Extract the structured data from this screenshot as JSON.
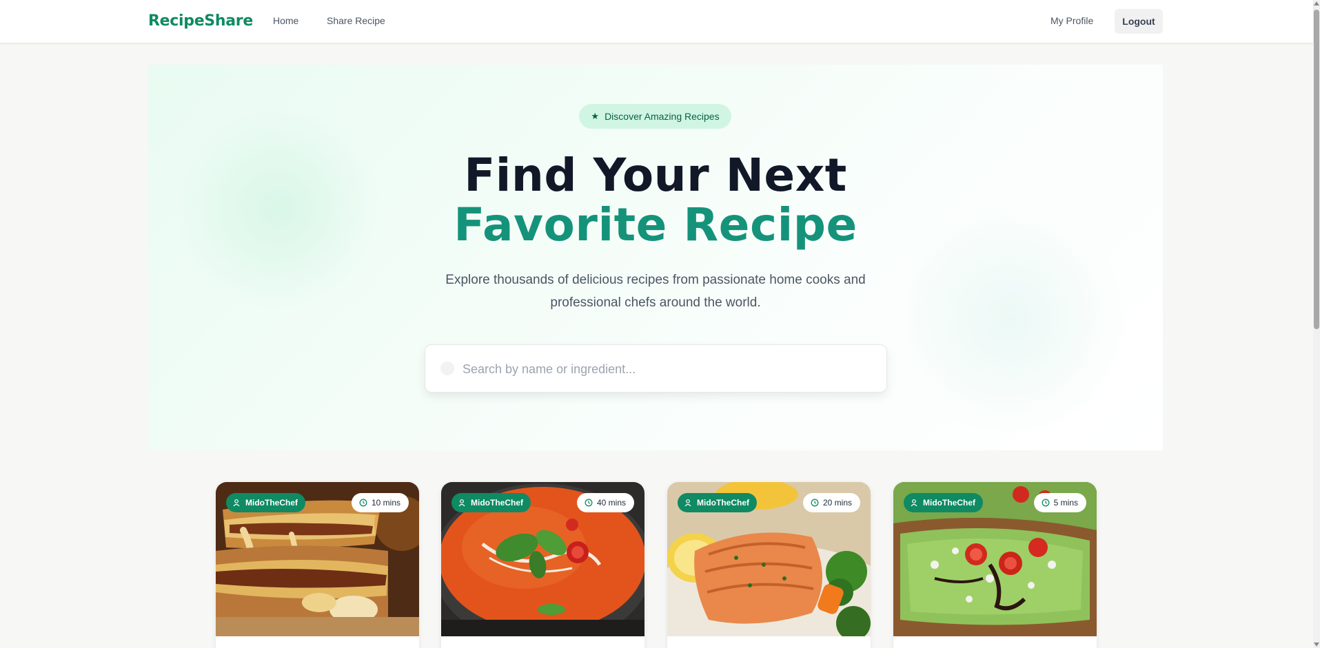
{
  "navbar": {
    "brand": "RecipeShare",
    "links": [
      "Home",
      "Share Recipe"
    ],
    "profile": "My Profile",
    "logout": "Logout"
  },
  "hero": {
    "badge": "Discover Amazing Recipes",
    "headline_line1": "Find Your Next",
    "headline_line2": "Favorite Recipe",
    "subtitle": "Explore thousands of delicious recipes from passionate home cooks and professional chefs around the world.",
    "search_placeholder": "Search by name or ingredient..."
  },
  "recipes": [
    {
      "chef": "MidoTheChef",
      "time": "10 mins",
      "image": "grilled-cheese-sandwich"
    },
    {
      "chef": "MidoTheChef",
      "time": "40 mins",
      "image": "tomato-soup"
    },
    {
      "chef": "MidoTheChef",
      "time": "20 mins",
      "image": "grilled-salmon"
    },
    {
      "chef": "MidoTheChef",
      "time": "5 mins",
      "image": "avocado-toast"
    }
  ],
  "colors": {
    "brand": "#0f8a63",
    "headline_dark": "#111827",
    "headline_accent": "#15937a",
    "badge_bg": "#d1f5e3"
  }
}
